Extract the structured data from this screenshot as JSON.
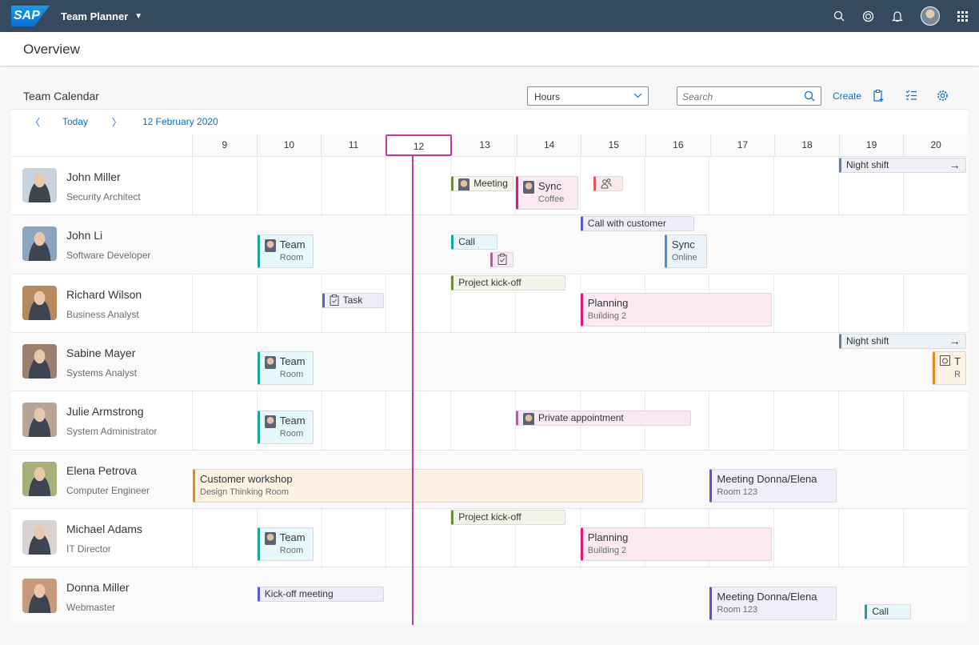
{
  "shell": {
    "logo": "SAP",
    "app_title": "Team Planner",
    "icons": [
      "search-icon",
      "copilot-icon",
      "bell-icon",
      "user-avatar",
      "grid-icon"
    ]
  },
  "header": {
    "title": "Overview"
  },
  "toolbar": {
    "title": "Team Calendar",
    "view_select": "Hours",
    "search_placeholder": "Search",
    "create_label": "Create"
  },
  "nav": {
    "today_label": "Today",
    "date_label": "12 February 2020"
  },
  "hours": [
    "9",
    "10",
    "11",
    "12",
    "13",
    "14",
    "15",
    "16",
    "17",
    "18",
    "19",
    "20"
  ],
  "today_hour": "12",
  "current_time_hour": 12.4,
  "people": [
    {
      "name": "John Miller",
      "role": "Security Architect",
      "photo": "#c9d3dc"
    },
    {
      "name": "John Li",
      "role": "Software Developer",
      "photo": "#8da4c0"
    },
    {
      "name": "Richard Wilson",
      "role": "Business Analyst",
      "photo": "#b58a5e"
    },
    {
      "name": "Sabine Mayer",
      "role": "Systems Analyst",
      "photo": "#9a8070"
    },
    {
      "name": "Julie Armstrong",
      "role": "System Administrator",
      "photo": "#b7a596"
    },
    {
      "name": "Elena Petrova",
      "role": "Computer Engineer",
      "photo": "#a8b07a"
    },
    {
      "name": "Michael Adams",
      "role": "IT Director",
      "photo": "#d9d4cf"
    },
    {
      "name": "Donna Miller",
      "role": "Webmaster",
      "photo": "#c69a7b"
    }
  ],
  "appointments": [
    {
      "row": 0,
      "start": 13.0,
      "end": 14.0,
      "lane": 1,
      "title": "Meeting",
      "thumb": true,
      "color": "#6c8a3c",
      "bg": "#f3f5ea"
    },
    {
      "row": 0,
      "start": 14.0,
      "end": 15.0,
      "lane": 1,
      "title": "Sync",
      "subtitle": "Coffee",
      "thumb": true,
      "color": "#e0177d",
      "bg": "#fde9f2"
    },
    {
      "row": 0,
      "start": 15.2,
      "end": 15.7,
      "lane": 1,
      "icon": "people-icon",
      "color": "#e3545b",
      "bg": "#fbeaea"
    },
    {
      "row": 0,
      "start": 19.0,
      "end": 21.0,
      "lane": 0,
      "title": "Night shift",
      "continues": true,
      "color": "#5b7fa6",
      "bg": "#eef1f5"
    },
    {
      "row": 1,
      "start": 15.0,
      "end": 16.8,
      "lane": 0,
      "title": "Call with customer",
      "color": "#5b5bd0",
      "bg": "#eeeefa"
    },
    {
      "row": 1,
      "start": 10.0,
      "end": 10.9,
      "lane": 1,
      "title": "Team",
      "subtitle": "Room",
      "thumb": true,
      "color": "#19a3a3",
      "bg": "#e6f8fb"
    },
    {
      "row": 1,
      "start": 13.0,
      "end": 13.75,
      "lane": 1,
      "title": "Call",
      "color": "#19a3a3",
      "bg": "#e6f8fb"
    },
    {
      "row": 1,
      "start": 13.6,
      "end": 14.0,
      "lane": 2,
      "icon": "clipboard-icon",
      "color": "#d148b8",
      "bg": "#fbe8f6"
    },
    {
      "row": 1,
      "start": 16.3,
      "end": 17.0,
      "lane": 1,
      "title": "Sync",
      "subtitle": "Online",
      "color": "#4a8fd6",
      "bg": "#ebf3fb"
    },
    {
      "row": 2,
      "start": 13.0,
      "end": 14.8,
      "lane": 0,
      "title": "Project kick-off",
      "color": "#6c8a3c",
      "bg": "#f3f5ea"
    },
    {
      "row": 2,
      "start": 11.0,
      "end": 12.0,
      "lane": 1,
      "title": "Task",
      "icon": "clipboard-icon",
      "color": "#5b5bd0",
      "bg": "#eeeefa"
    },
    {
      "row": 2,
      "start": 15.0,
      "end": 18.0,
      "lane": 1,
      "title": "Planning",
      "subtitle": "Building 2",
      "color": "#e0177d",
      "bg": "#fde9f2"
    },
    {
      "row": 3,
      "start": 19.0,
      "end": 21.0,
      "lane": 0,
      "title": "Night shift",
      "continues": true,
      "color": "#5b7fa6",
      "bg": "#eef1f5"
    },
    {
      "row": 3,
      "start": 10.0,
      "end": 10.9,
      "lane": 1,
      "title": "Team",
      "subtitle": "Room",
      "thumb": true,
      "color": "#19a3a3",
      "bg": "#e6f8fb"
    },
    {
      "row": 3,
      "start": 20.45,
      "end": 21.0,
      "lane": 1,
      "title": "T",
      "subtitle": "R",
      "icon": "camera-icon",
      "color": "#e38a1a",
      "bg": "#fdf2e4"
    },
    {
      "row": 4,
      "start": 10.0,
      "end": 10.9,
      "lane": 1,
      "title": "Team",
      "subtitle": "Room",
      "thumb": true,
      "color": "#19a3a3",
      "bg": "#e6f8fb"
    },
    {
      "row": 4,
      "start": 14.0,
      "end": 16.75,
      "lane": 1,
      "title": "Private appointment",
      "thumb": true,
      "color": "#d148b8",
      "bg": "#fbe8f6"
    },
    {
      "row": 5,
      "start": 9.0,
      "end": 16.0,
      "lane": 1,
      "title": "Customer workshop",
      "subtitle": "Design Thinking Room",
      "color": "#e38a1a",
      "bg": "#fdf2e4"
    },
    {
      "row": 5,
      "start": 17.0,
      "end": 19.0,
      "lane": 1,
      "title": "Meeting Donna/Elena",
      "subtitle": "Room 123",
      "color": "#5d4fc4",
      "bg": "#efeefa"
    },
    {
      "row": 6,
      "start": 13.0,
      "end": 14.8,
      "lane": 0,
      "title": "Project kick-off",
      "color": "#6c8a3c",
      "bg": "#f3f5ea"
    },
    {
      "row": 6,
      "start": 10.0,
      "end": 10.9,
      "lane": 1,
      "title": "Team",
      "subtitle": "Room",
      "thumb": true,
      "color": "#19a3a3",
      "bg": "#e6f8fb"
    },
    {
      "row": 6,
      "start": 15.0,
      "end": 18.0,
      "lane": 1,
      "title": "Planning",
      "subtitle": "Building 2",
      "color": "#e0177d",
      "bg": "#fde9f2"
    },
    {
      "row": 7,
      "start": 10.0,
      "end": 12.0,
      "lane": 1,
      "title": "Kick-off meeting",
      "color": "#5b5bd0",
      "bg": "#eeeefa"
    },
    {
      "row": 7,
      "start": 17.0,
      "end": 19.0,
      "lane": 1,
      "title": "Meeting Donna/Elena",
      "subtitle": "Room 123",
      "color": "#5d4fc4",
      "bg": "#efeefa"
    },
    {
      "row": 7,
      "start": 19.4,
      "end": 20.15,
      "lane": 2,
      "title": "Call",
      "color": "#19a3a3",
      "bg": "#e6f8fb"
    }
  ],
  "colors": {
    "shell": "#354a5f",
    "accent": "#0a6ed1",
    "today": "#c0399f"
  }
}
